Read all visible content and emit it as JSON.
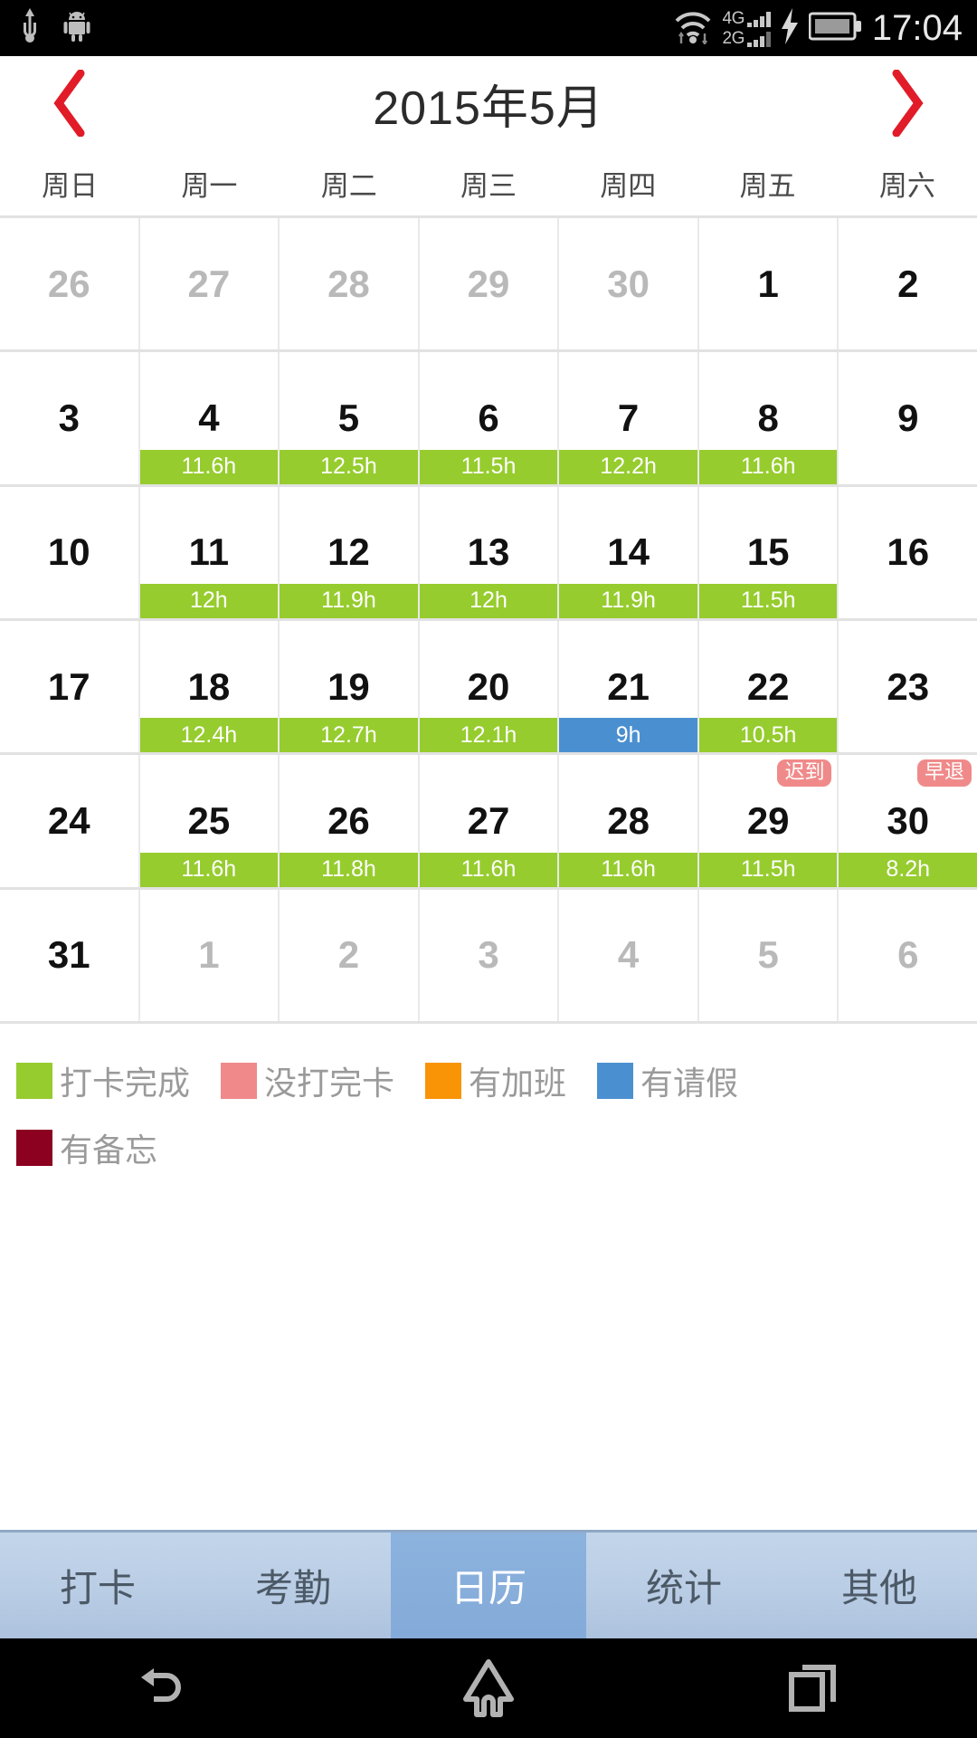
{
  "status_bar": {
    "time": "17:04",
    "network_labels": [
      "4G",
      "2G"
    ],
    "icons": [
      "usb-icon",
      "android-robot-icon",
      "wifi-icon",
      "signal-icon",
      "charging-bolt-icon",
      "battery-icon"
    ]
  },
  "header": {
    "title": "2015年5月",
    "prev_label": "‹",
    "next_label": "›",
    "arrow_color": "#e11b28"
  },
  "weekdays": [
    "周日",
    "周一",
    "周二",
    "周三",
    "周四",
    "周五",
    "周六"
  ],
  "colors": {
    "complete": "#96cc2e",
    "incomplete": "#f08a8a",
    "overtime": "#f89406",
    "leave": "#4a90d0",
    "memo": "#8c0020",
    "grid": "#e2e2e2",
    "out_of_month_text": "#b9b9b9"
  },
  "weeks": [
    [
      {
        "day": "26",
        "out": true
      },
      {
        "day": "27",
        "out": true
      },
      {
        "day": "28",
        "out": true
      },
      {
        "day": "29",
        "out": true
      },
      {
        "day": "30",
        "out": true
      },
      {
        "day": "1",
        "out": false
      },
      {
        "day": "2",
        "out": false
      }
    ],
    [
      {
        "day": "3",
        "out": false
      },
      {
        "day": "4",
        "out": false,
        "hours": "11.6h",
        "bar": "complete"
      },
      {
        "day": "5",
        "out": false,
        "hours": "12.5h",
        "bar": "complete"
      },
      {
        "day": "6",
        "out": false,
        "hours": "11.5h",
        "bar": "complete"
      },
      {
        "day": "7",
        "out": false,
        "hours": "12.2h",
        "bar": "complete"
      },
      {
        "day": "8",
        "out": false,
        "hours": "11.6h",
        "bar": "complete"
      },
      {
        "day": "9",
        "out": false
      }
    ],
    [
      {
        "day": "10",
        "out": false
      },
      {
        "day": "11",
        "out": false,
        "hours": "12h",
        "bar": "complete"
      },
      {
        "day": "12",
        "out": false,
        "hours": "11.9h",
        "bar": "complete"
      },
      {
        "day": "13",
        "out": false,
        "hours": "12h",
        "bar": "complete"
      },
      {
        "day": "14",
        "out": false,
        "hours": "11.9h",
        "bar": "complete"
      },
      {
        "day": "15",
        "out": false,
        "hours": "11.5h",
        "bar": "complete"
      },
      {
        "day": "16",
        "out": false
      }
    ],
    [
      {
        "day": "17",
        "out": false
      },
      {
        "day": "18",
        "out": false,
        "hours": "12.4h",
        "bar": "complete"
      },
      {
        "day": "19",
        "out": false,
        "hours": "12.7h",
        "bar": "complete"
      },
      {
        "day": "20",
        "out": false,
        "hours": "12.1h",
        "bar": "complete"
      },
      {
        "day": "21",
        "out": false,
        "hours": "9h",
        "bar": "leave"
      },
      {
        "day": "22",
        "out": false,
        "hours": "10.5h",
        "bar": "complete"
      },
      {
        "day": "23",
        "out": false
      }
    ],
    [
      {
        "day": "24",
        "out": false
      },
      {
        "day": "25",
        "out": false,
        "hours": "11.6h",
        "bar": "complete"
      },
      {
        "day": "26",
        "out": false,
        "hours": "11.8h",
        "bar": "complete"
      },
      {
        "day": "27",
        "out": false,
        "hours": "11.6h",
        "bar": "complete"
      },
      {
        "day": "28",
        "out": false,
        "hours": "11.6h",
        "bar": "complete"
      },
      {
        "day": "29",
        "out": false,
        "hours": "11.5h",
        "bar": "complete",
        "badge": "迟到"
      },
      {
        "day": "30",
        "out": false,
        "hours": "8.2h",
        "bar": "complete",
        "badge": "早退"
      }
    ],
    [
      {
        "day": "31",
        "out": false
      },
      {
        "day": "1",
        "out": true
      },
      {
        "day": "2",
        "out": true
      },
      {
        "day": "3",
        "out": true
      },
      {
        "day": "4",
        "out": true
      },
      {
        "day": "5",
        "out": true
      },
      {
        "day": "6",
        "out": true
      }
    ]
  ],
  "legend": [
    {
      "label": "打卡完成",
      "color": "#96cc2e"
    },
    {
      "label": "没打完卡",
      "color": "#f08a8a"
    },
    {
      "label": "有加班",
      "color": "#f89406"
    },
    {
      "label": "有请假",
      "color": "#4a90d0"
    },
    {
      "label": "有备忘",
      "color": "#8c0020"
    }
  ],
  "tabs": [
    {
      "label": "打卡",
      "active": false
    },
    {
      "label": "考勤",
      "active": false
    },
    {
      "label": "日历",
      "active": true
    },
    {
      "label": "统计",
      "active": false
    },
    {
      "label": "其他",
      "active": false
    }
  ],
  "navbar": {
    "back": "back-icon",
    "home": "home-icon",
    "recents": "recents-icon"
  }
}
